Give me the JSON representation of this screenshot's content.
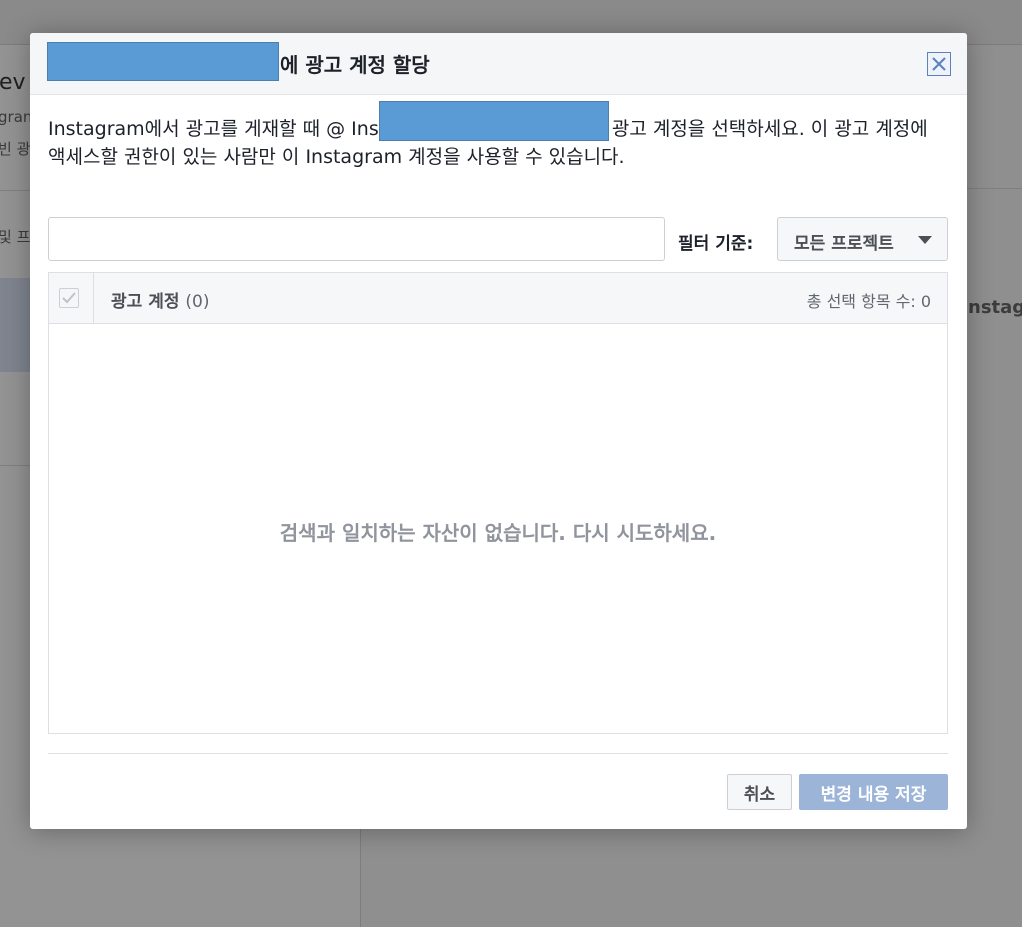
{
  "background": {
    "fragments": [
      "ev",
      "gran",
      "빈 광",
      "및 프",
      "nstag"
    ]
  },
  "dialog": {
    "title_suffix": "에 광고 계정 할당",
    "description": "Instagram에서 광고를 게재할 때 @ Instagram 계정과 함께 사용할 광고 계정을 선택하세요. 이 광고 계정에 액세스할 권한이 있는 사람만 이 Instagram 계정을 사용할 수 있습니다.",
    "search": {
      "value": "",
      "placeholder": ""
    },
    "filter": {
      "label": "필터 기준:",
      "selected": "모든 프로젝트"
    },
    "table": {
      "column_label": "광고 계정",
      "column_count": "(0)",
      "selected_count": "총 선택 항목 수: 0",
      "empty_message": "검색과 일치하는 자산이 없습니다. 다시 시도하세요."
    },
    "buttons": {
      "cancel": "취소",
      "save": "변경 내용 저장"
    }
  },
  "colors": {
    "accent": "#5f7fbd",
    "save_disabled": "#9cb4d8",
    "redaction": "#5b9bd5",
    "overlay": "#8f8f8f"
  },
  "icons": {
    "close": "close-icon",
    "caret": "caret-down-icon",
    "check": "check-icon"
  }
}
